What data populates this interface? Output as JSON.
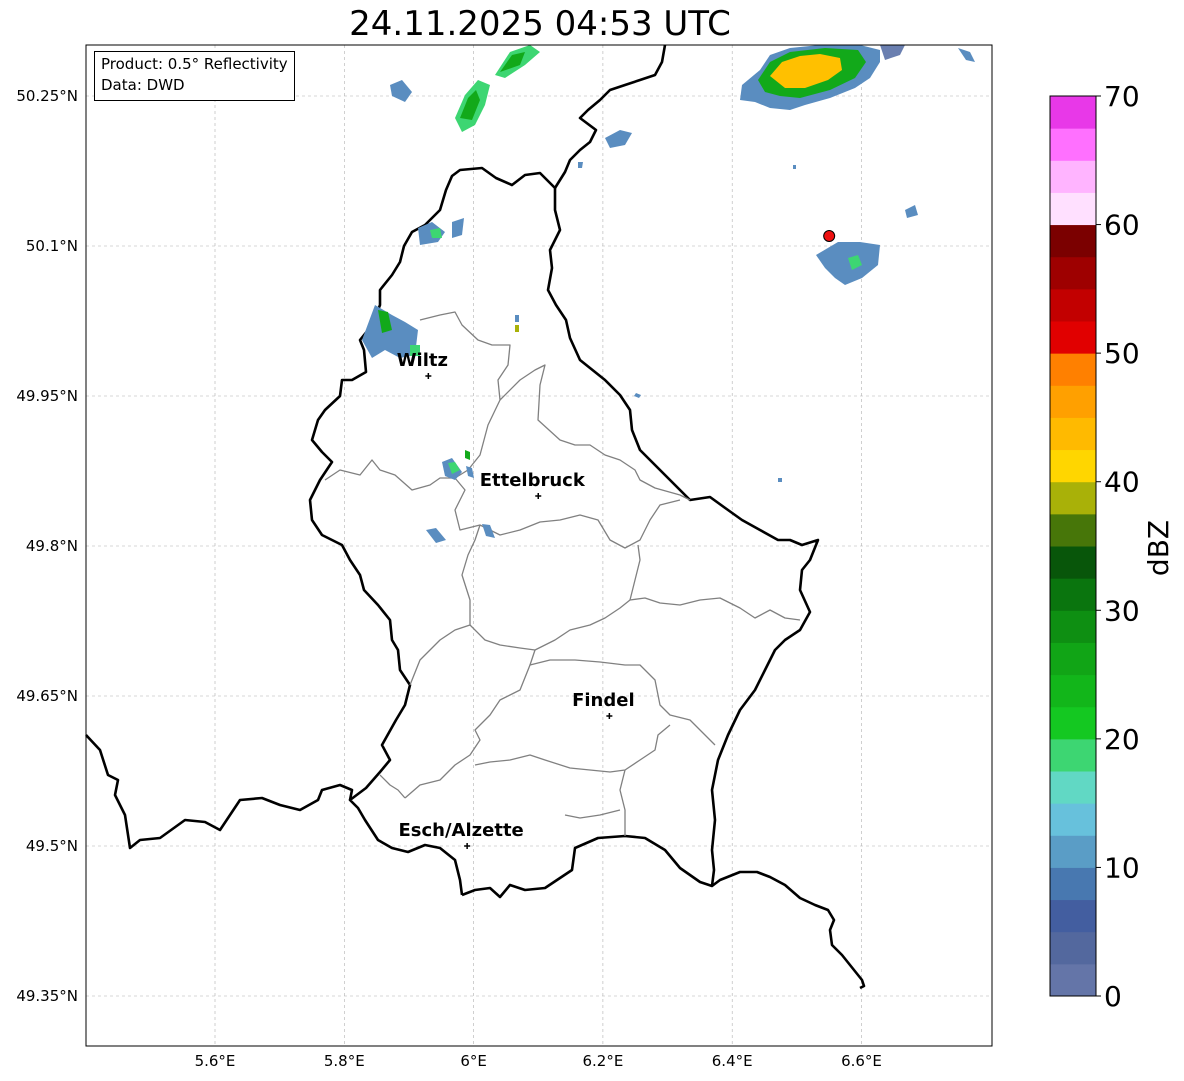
{
  "title": "24.11.2025 04:53 UTC",
  "info": {
    "product": "Product: 0.5° Reflectivity",
    "data_source": "Data: DWD"
  },
  "axes": {
    "lon_ticks": [
      "5.6°E",
      "5.8°E",
      "6°E",
      "6.2°E",
      "6.4°E",
      "6.6°E"
    ],
    "lat_ticks": [
      "50.25°N",
      "50.1°N",
      "49.95°N",
      "49.8°N",
      "49.65°N",
      "49.5°N",
      "49.35°N"
    ]
  },
  "cities": [
    {
      "name": "Wiltz",
      "lon": 5.93,
      "lat": 49.97
    },
    {
      "name": "Ettelbruck",
      "lon": 6.1,
      "lat": 49.85
    },
    {
      "name": "Findel",
      "lon": 6.21,
      "lat": 49.63
    },
    {
      "name": "Esch/Alzette",
      "lon": 5.99,
      "lat": 49.5
    }
  ],
  "radar_site": {
    "lon": 6.55,
    "lat": 50.11,
    "color": "#ee1111"
  },
  "colorbar": {
    "label": "dBZ",
    "tick_labels": [
      "0",
      "10",
      "20",
      "30",
      "40",
      "50",
      "60",
      "70"
    ],
    "colors": [
      "#6475a8",
      "#53689e",
      "#435ea0",
      "#4878b0",
      "#5a9dc6",
      "#67c1dc",
      "#61d8c4",
      "#3dd672",
      "#14c821",
      "#12b61a",
      "#11a516",
      "#0e8f12",
      "#0a750e",
      "#08560a",
      "#477609",
      "#a9b108",
      "#ffd600",
      "#ffba00",
      "#ffa000",
      "#ff8000",
      "#e10000",
      "#c20000",
      "#9e0000",
      "#7b0000",
      "#ffe0ff",
      "#ffb4ff",
      "#ff70ff",
      "#e838e8"
    ]
  }
}
